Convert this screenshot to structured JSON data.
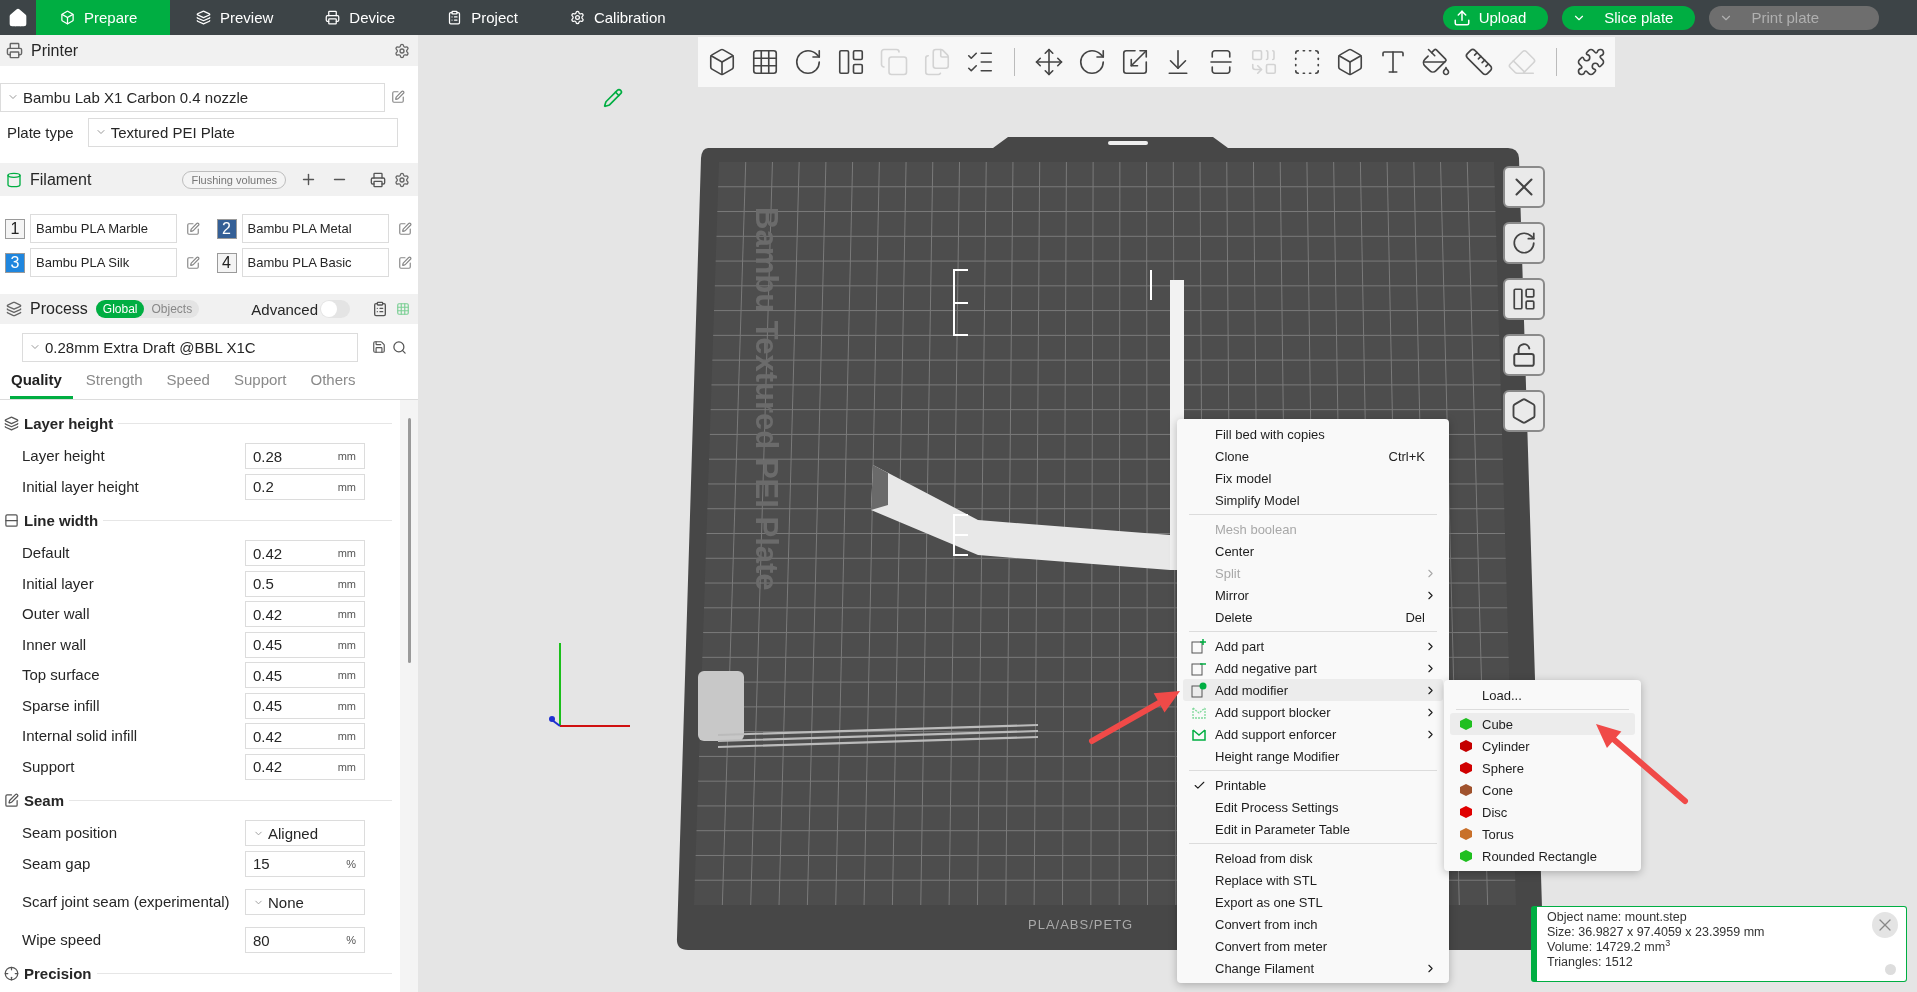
{
  "topbar": {
    "tabs": [
      {
        "label": "Prepare",
        "kind": "prepare",
        "selected": true
      },
      {
        "label": "Preview",
        "kind": "preview",
        "selected": false
      },
      {
        "label": "Device",
        "kind": "device",
        "selected": false
      },
      {
        "label": "Project",
        "kind": "project",
        "selected": false
      },
      {
        "label": "Calibration",
        "kind": "calibration",
        "selected": false
      }
    ],
    "actions": [
      {
        "label": "Upload",
        "kind": "upload",
        "disabled": false
      },
      {
        "label": "Slice plate",
        "kind": "dropdown",
        "disabled": false
      },
      {
        "label": "Print plate",
        "kind": "dropdown",
        "disabled": true
      }
    ]
  },
  "printer": {
    "title": "Printer",
    "preset": "Bambu Lab X1 Carbon 0.4 nozzle",
    "plate_type_label": "Plate type",
    "plate_type": "Textured PEI Plate"
  },
  "filament": {
    "title": "Filament",
    "flushing_button": "Flushing volumes",
    "slots": [
      {
        "number": "1",
        "name": "Bambu PLA Marble",
        "color": "#f4f4f4"
      },
      {
        "number": "2",
        "name": "Bambu PLA Metal",
        "color": "#345f96"
      },
      {
        "number": "3",
        "name": "Bambu PLA Silk",
        "color": "#1f86de"
      },
      {
        "number": "4",
        "name": "Bambu PLA Basic",
        "color": "#f4f4f4"
      }
    ]
  },
  "process": {
    "title": "Process",
    "modes": [
      {
        "label": "Global",
        "selected": true
      },
      {
        "label": "Objects",
        "selected": false
      }
    ],
    "advanced_label": "Advanced",
    "advanced_on": false,
    "preset": "0.28mm Extra Draft @BBL X1C",
    "tabs": [
      {
        "label": "Quality",
        "selected": true
      },
      {
        "label": "Strength",
        "selected": false
      },
      {
        "label": "Speed",
        "selected": false
      },
      {
        "label": "Support",
        "selected": false
      },
      {
        "label": "Others",
        "selected": false
      }
    ]
  },
  "settings": [
    {
      "title": "Layer height",
      "kind": "layers",
      "rows": [
        {
          "label": "Layer height",
          "kind": "number",
          "value": "0.28",
          "unit": "mm"
        },
        {
          "label": "Initial layer height",
          "kind": "number",
          "value": "0.2",
          "unit": "mm"
        }
      ]
    },
    {
      "title": "Line width",
      "kind": "width",
      "rows": [
        {
          "label": "Default",
          "kind": "number",
          "value": "0.42",
          "unit": "mm"
        },
        {
          "label": "Initial layer",
          "kind": "number",
          "value": "0.5",
          "unit": "mm"
        },
        {
          "label": "Outer wall",
          "kind": "number",
          "value": "0.42",
          "unit": "mm"
        },
        {
          "label": "Inner wall",
          "kind": "number",
          "value": "0.45",
          "unit": "mm"
        },
        {
          "label": "Top surface",
          "kind": "number",
          "value": "0.45",
          "unit": "mm"
        },
        {
          "label": "Sparse infill",
          "kind": "number",
          "value": "0.45",
          "unit": "mm"
        },
        {
          "label": "Internal solid infill",
          "kind": "number",
          "value": "0.42",
          "unit": "mm"
        },
        {
          "label": "Support",
          "kind": "number",
          "value": "0.42",
          "unit": "mm"
        }
      ]
    },
    {
      "title": "Seam",
      "kind": "seam",
      "rows": [
        {
          "label": "Seam position",
          "kind": "select",
          "value": "Aligned"
        },
        {
          "label": "Seam gap",
          "kind": "number",
          "value": "15",
          "unit": "%"
        },
        {
          "label": "Scarf joint seam (experimental)",
          "kind": "select",
          "value": "None"
        },
        {
          "label": "Wipe speed",
          "kind": "number",
          "value": "80",
          "unit": "%"
        }
      ]
    },
    {
      "title": "Precision",
      "kind": "precision"
    }
  ],
  "toolbar": [
    [
      {
        "kind": "add-object",
        "disabled": false
      },
      {
        "kind": "add-plate",
        "disabled": false
      },
      {
        "kind": "auto-orient",
        "disabled": false
      },
      {
        "kind": "arrange",
        "disabled": false
      },
      {
        "kind": "split-objects",
        "disabled": true
      },
      {
        "kind": "split-parts",
        "disabled": true
      },
      {
        "kind": "layers",
        "disabled": false
      }
    ],
    [
      {
        "kind": "move",
        "disabled": false
      },
      {
        "kind": "rotate",
        "disabled": false
      },
      {
        "kind": "scale",
        "disabled": false
      },
      {
        "kind": "lay-flat",
        "disabled": false
      },
      {
        "kind": "cut",
        "disabled": false
      },
      {
        "kind": "boolean",
        "disabled": true
      },
      {
        "kind": "support-paint",
        "disabled": false
      },
      {
        "kind": "seam-paint",
        "disabled": false
      },
      {
        "kind": "text",
        "disabled": false
      },
      {
        "kind": "color-paint",
        "disabled": false
      },
      {
        "kind": "measure",
        "disabled": false
      },
      {
        "kind": "assembly",
        "disabled": true
      }
    ],
    [
      {
        "kind": "explode",
        "disabled": false
      }
    ]
  ],
  "canvas": {
    "plate_label": "Bambu Textured PEI Plate",
    "plate_material": "PLA/ABS/PETG",
    "context_menu": [
      [
        {
          "label": "Fill bed with copies",
          "kind": "plain",
          "disabled": false,
          "has_submenu": false,
          "checked": false,
          "highlighted": false
        },
        {
          "label": "Clone",
          "shortcut": "Ctrl+K",
          "kind": "plain",
          "disabled": false,
          "has_submenu": false,
          "checked": false,
          "highlighted": false
        },
        {
          "label": "Fix model",
          "kind": "plain",
          "disabled": false,
          "has_submenu": false,
          "checked": false,
          "highlighted": false
        },
        {
          "label": "Simplify Model",
          "kind": "plain",
          "disabled": false,
          "has_submenu": false,
          "checked": false,
          "highlighted": false
        }
      ],
      [
        {
          "label": "Mesh boolean",
          "kind": "plain",
          "disabled": true,
          "has_submenu": false,
          "checked": false,
          "highlighted": false
        },
        {
          "label": "Center",
          "kind": "plain",
          "disabled": false,
          "has_submenu": false,
          "checked": false,
          "highlighted": false
        },
        {
          "label": "Split",
          "kind": "plain",
          "disabled": true,
          "has_submenu": true,
          "checked": false,
          "highlighted": false
        },
        {
          "label": "Mirror",
          "kind": "plain",
          "disabled": false,
          "has_submenu": true,
          "checked": false,
          "highlighted": false
        },
        {
          "label": "Delete",
          "shortcut": "Del",
          "kind": "plain",
          "disabled": false,
          "has_submenu": false,
          "checked": false,
          "highlighted": false
        }
      ],
      [
        {
          "label": "Add part",
          "kind": "part",
          "disabled": false,
          "has_submenu": true,
          "checked": false,
          "highlighted": false
        },
        {
          "label": "Add negative part",
          "kind": "negative",
          "disabled": false,
          "has_submenu": true,
          "checked": false,
          "highlighted": false
        },
        {
          "label": "Add modifier",
          "kind": "modifier",
          "disabled": false,
          "has_submenu": true,
          "checked": false,
          "highlighted": true
        },
        {
          "label": "Add support blocker",
          "kind": "blocker",
          "disabled": false,
          "has_submenu": true,
          "checked": false,
          "highlighted": false
        },
        {
          "label": "Add support enforcer",
          "kind": "enforcer",
          "disabled": false,
          "has_submenu": true,
          "checked": false,
          "highlighted": false
        },
        {
          "label": "Height range Modifier",
          "kind": "plain",
          "disabled": false,
          "has_submenu": false,
          "checked": false,
          "highlighted": false
        }
      ],
      [
        {
          "label": "Printable",
          "kind": "plain",
          "disabled": false,
          "has_submenu": false,
          "checked": true,
          "highlighted": false
        },
        {
          "label": "Edit Process Settings",
          "kind": "plain",
          "disabled": false,
          "has_submenu": false,
          "checked": false,
          "highlighted": false
        },
        {
          "label": "Edit in Parameter Table",
          "kind": "plain",
          "disabled": false,
          "has_submenu": false,
          "checked": false,
          "highlighted": false
        }
      ],
      [
        {
          "label": "Reload from disk",
          "kind": "plain",
          "disabled": false,
          "has_submenu": false,
          "checked": false,
          "highlighted": false
        },
        {
          "label": "Replace with STL",
          "kind": "plain",
          "disabled": false,
          "has_submenu": false,
          "checked": false,
          "highlighted": false
        },
        {
          "label": "Export as one STL",
          "kind": "plain",
          "disabled": false,
          "has_submenu": false,
          "checked": false,
          "highlighted": false
        },
        {
          "label": "Convert from inch",
          "kind": "plain",
          "disabled": false,
          "has_submenu": false,
          "checked": false,
          "highlighted": false
        },
        {
          "label": "Convert from meter",
          "kind": "plain",
          "disabled": false,
          "has_submenu": false,
          "checked": false,
          "highlighted": false
        },
        {
          "label": "Change Filament",
          "kind": "plain",
          "disabled": false,
          "has_submenu": true,
          "checked": false,
          "highlighted": false
        }
      ]
    ],
    "submenu": {
      "load": "Load...",
      "shapes": [
        {
          "label": "Cube",
          "color": "#1fbf1f",
          "selected": true
        },
        {
          "label": "Cylinder",
          "color": "#c40000",
          "selected": false
        },
        {
          "label": "Sphere",
          "color": "#d00000",
          "selected": false
        },
        {
          "label": "Cone",
          "color": "#a0522d",
          "selected": false
        },
        {
          "label": "Disc",
          "color": "#e00000",
          "selected": false
        },
        {
          "label": "Torus",
          "color": "#c8702a",
          "selected": false
        },
        {
          "label": "Rounded Rectangle",
          "color": "#1fbf1f",
          "selected": false
        }
      ]
    },
    "info": [
      "Object name: mount.step",
      "Size: 36.9827 x 97.4059 x 23.3959 mm",
      "Volume: 14729.2 mm$^{3}$",
      "Triangles: 1512"
    ]
  }
}
